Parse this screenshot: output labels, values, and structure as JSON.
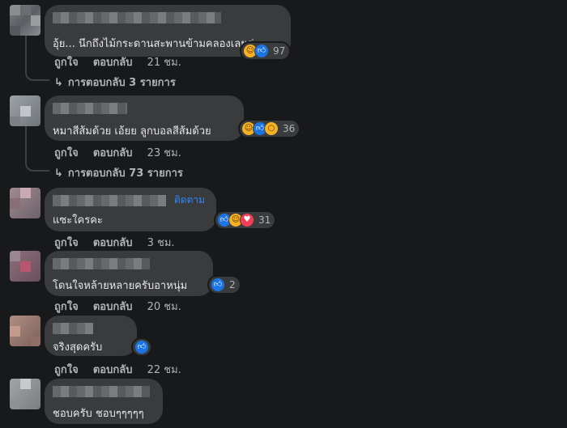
{
  "comments": [
    {
      "text": "อุ้ย... นึกถึงไม้กระดานสะพานข้ามคลองเลยค่ะ",
      "reactions": [
        "haha",
        "like"
      ],
      "reaction_count": "97",
      "like_label": "ถูกใจ",
      "reply_label": "ตอบกลับ",
      "time": "21 ชม.",
      "replies_label": "การตอบกลับ 3 รายการ"
    },
    {
      "text": "หมาสีส้มด้วย เอ้ยย ลูกบอลสีส้มด้วย",
      "reactions": [
        "haha",
        "like",
        "wow"
      ],
      "reaction_count": "36",
      "like_label": "ถูกใจ",
      "reply_label": "ตอบกลับ",
      "time": "23 ชม.",
      "replies_label": "การตอบกลับ 73 รายการ"
    },
    {
      "text": "แซะใครคะ",
      "follow_label": "ติดตาม",
      "reactions": [
        "like",
        "haha",
        "love"
      ],
      "reaction_count": "31",
      "like_label": "ถูกใจ",
      "reply_label": "ตอบกลับ",
      "time": "3 ชม."
    },
    {
      "text": "โดนใจหล้ายหลายครับอาหนุ่ม",
      "reactions": [
        "like"
      ],
      "reaction_count": "2",
      "like_label": "ถูกใจ",
      "reply_label": "ตอบกลับ",
      "time": "20 ชม."
    },
    {
      "text": "จริงสุดครับ",
      "reactions": [
        "like"
      ],
      "reaction_count": "",
      "like_label": "ถูกใจ",
      "reply_label": "ตอบกลับ",
      "time": "22 ชม."
    },
    {
      "text": "ชอบครับ ชอบๆๆๆๆๆ"
    }
  ],
  "icons": {
    "like": "like-reaction-icon",
    "haha": "haha-reaction-icon",
    "wow": "wow-reaction-icon",
    "love": "love-reaction-icon",
    "reply_arrow": "reply-arrow-icon"
  },
  "colors": {
    "background": "#18191a",
    "bubble": "#3a3b3c",
    "link": "#2d88ff",
    "like": "#1b74e4",
    "love": "#f33e58",
    "haha": "#f7b125"
  }
}
